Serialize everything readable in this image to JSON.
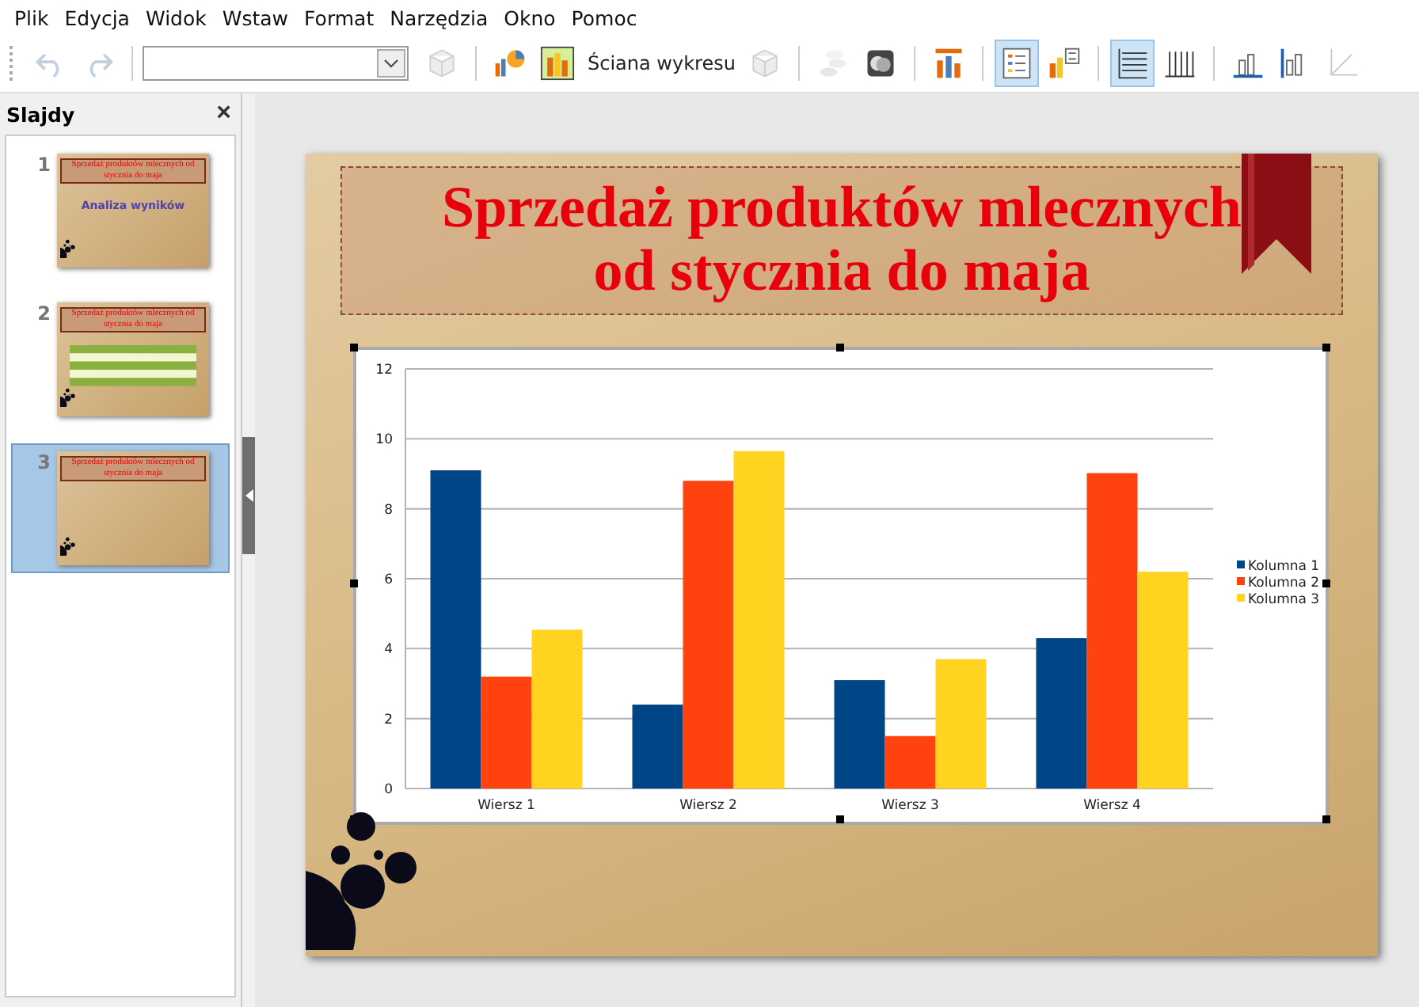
{
  "menu": [
    {
      "label": "Plik"
    },
    {
      "label": "Edycja"
    },
    {
      "label": "Widok"
    },
    {
      "label": "Wstaw"
    },
    {
      "label": "Format"
    },
    {
      "label": "Narzędzia"
    },
    {
      "label": "Okno"
    },
    {
      "label": "Pomoc"
    }
  ],
  "toolbar": {
    "groups": [
      {
        "items": [
          {
            "kind": "undo",
            "disabled": true,
            "selected": false
          },
          {
            "kind": "redo",
            "disabled": true,
            "selected": false
          }
        ]
      },
      {
        "items": [
          {
            "kind": "combo"
          },
          {
            "kind": "cube",
            "disabled": true,
            "selected": false
          }
        ]
      },
      {
        "items": [
          {
            "kind": "chart-type",
            "disabled": false,
            "selected": false
          },
          {
            "kind": "wall",
            "disabled": false,
            "selected": false
          },
          {
            "kind": "text",
            "label": "Ściana wykresu",
            "disabled": false,
            "selected": false
          },
          {
            "kind": "view3d",
            "disabled": true,
            "selected": false
          }
        ]
      },
      {
        "items": [
          {
            "kind": "stack",
            "disabled": true,
            "selected": false
          },
          {
            "kind": "data",
            "disabled": false,
            "selected": false
          }
        ]
      },
      {
        "items": [
          {
            "kind": "title",
            "disabled": false,
            "selected": false
          }
        ]
      },
      {
        "items": [
          {
            "kind": "legend",
            "disabled": false,
            "selected": true
          },
          {
            "kind": "legend-pos",
            "disabled": false,
            "selected": false
          }
        ]
      },
      {
        "items": [
          {
            "kind": "hgrid",
            "disabled": false,
            "selected": true
          },
          {
            "kind": "vgrid",
            "disabled": false,
            "selected": false
          }
        ]
      },
      {
        "items": [
          {
            "kind": "xaxis",
            "disabled": false,
            "selected": false
          },
          {
            "kind": "yaxis",
            "disabled": false,
            "selected": false
          },
          {
            "kind": "zaxis",
            "disabled": true,
            "selected": false
          }
        ]
      }
    ]
  },
  "sidebar": {
    "title": "Slajdy",
    "close": "×",
    "slides": [
      {
        "number": "1",
        "kind": "title",
        "selected": false,
        "title": "Sprzedaż produktów mlecznych od stycznia do maja",
        "subtitle": "Analiza wyników"
      },
      {
        "number": "2",
        "kind": "table",
        "selected": false,
        "title": "Sprzedaż produktów mlecznych od stycznia do maja"
      },
      {
        "number": "3",
        "kind": "blank",
        "selected": true,
        "title": "Sprzedaż produktów mlecznych od stycznia do maja"
      }
    ]
  },
  "slide": {
    "title_lines": [
      "Sprzedaż produktów mlecznych",
      "od stycznia do maja"
    ],
    "chart_data": {
      "type": "bar",
      "categories": [
        "Wiersz 1",
        "Wiersz 2",
        "Wiersz 3",
        "Wiersz 4"
      ],
      "series": [
        {
          "name": "Kolumna 1",
          "color": "#004586",
          "values": [
            9.1,
            2.4,
            3.1,
            4.3
          ]
        },
        {
          "name": "Kolumna 2",
          "color": "#ff420e",
          "values": [
            3.2,
            8.8,
            1.5,
            9.02
          ]
        },
        {
          "name": "Kolumna 3",
          "color": "#ffd320",
          "values": [
            4.54,
            9.65,
            3.7,
            6.2
          ]
        }
      ],
      "ylim": [
        0,
        12
      ],
      "yticks": [
        0,
        2,
        4,
        6,
        8,
        10,
        12
      ],
      "grid": true,
      "legend": true
    }
  }
}
